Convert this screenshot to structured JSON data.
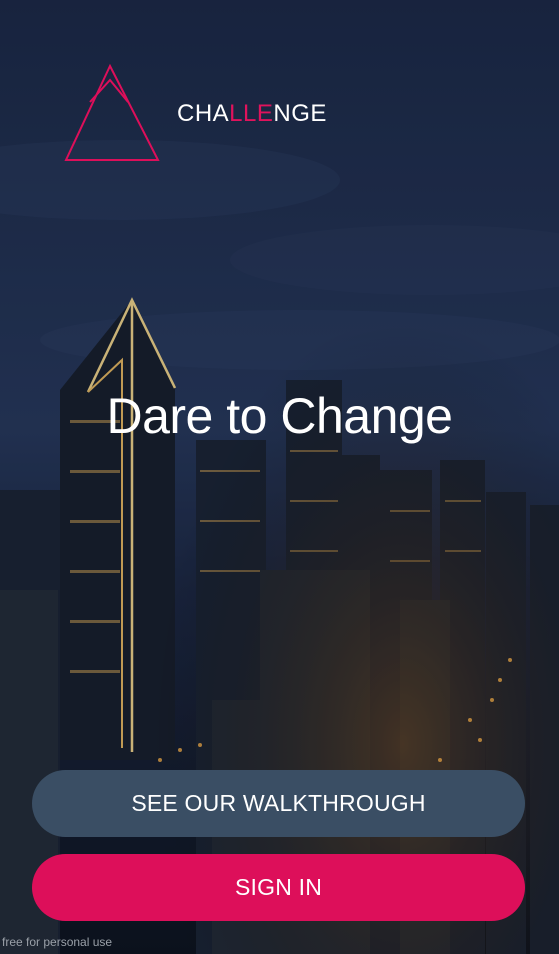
{
  "app": {
    "brand_parts": [
      "CHA",
      "LLE",
      "NGE"
    ],
    "headline": "Dare to Change",
    "colors": {
      "accent": "#dd0f5a",
      "secondary_button": "#3a4e64",
      "text": "#ffffff"
    }
  },
  "actions": {
    "walkthrough_label": "SEE OUR WALKTHROUGH",
    "sign_in_label": "SIGN IN"
  },
  "footer": {
    "note": "free for personal use"
  },
  "icons": {
    "logo": "triangle-logo-icon",
    "background": "city-skyline-night"
  }
}
